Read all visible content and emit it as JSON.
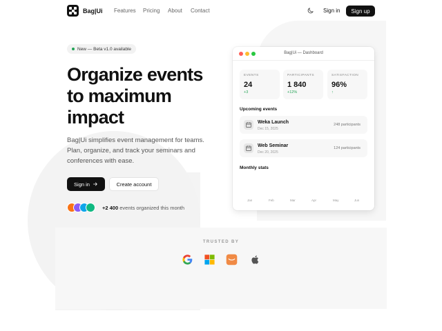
{
  "nav": {
    "brand": "Bag|Ui",
    "links": [
      "Features",
      "Pricing",
      "About",
      "Contact"
    ],
    "signin": "Sign in",
    "signup": "Sign up"
  },
  "hero": {
    "badge": "New — Beta v1.0 available",
    "title_lines": [
      "Organize events",
      "to maximum",
      "impact"
    ],
    "description_lines": [
      "Bag|Ui simplifies event management for teams.",
      "Plan, organize, and track your seminars and",
      "conferences with ease."
    ],
    "primary_cta": "Sign in",
    "secondary_cta": "Create account",
    "social_count": "+2 400",
    "social_text": "events organized this month"
  },
  "dashboard": {
    "window_title": "Bag|Ui — Dashboard",
    "stats": [
      {
        "label": "EVENTS",
        "value": "24",
        "change": "+3"
      },
      {
        "label": "PARTICIPANTS",
        "value": "1 840",
        "change": "+12%"
      },
      {
        "label": "SATISFACTION",
        "value": "96%",
        "change": "↑"
      }
    ],
    "upcoming_heading": "Upcoming events",
    "events": [
      {
        "name": "Weka Launch",
        "date": "Dec 15, 2025",
        "participants": "248 participants"
      },
      {
        "name": "Web Seminar",
        "date": "Dec 20, 2025",
        "participants": "124 participants"
      }
    ],
    "monthly_heading": "Monthly stats",
    "months": [
      "Jan",
      "Feb",
      "Mar",
      "Apr",
      "May",
      "Jun"
    ]
  },
  "trusted": {
    "heading": "TRUSTED BY",
    "brands": [
      "google-icon",
      "microsoft-icon",
      "ubuntu-icon",
      "apple-icon"
    ]
  },
  "colors": {
    "primary": "#111111",
    "accent_green": "#22a355",
    "avatars": [
      "#f97316",
      "#8b5cf6",
      "#0ea5e9",
      "#10b981"
    ],
    "traffic_lights": [
      "#ff5f57",
      "#febc2e",
      "#28c840"
    ]
  }
}
